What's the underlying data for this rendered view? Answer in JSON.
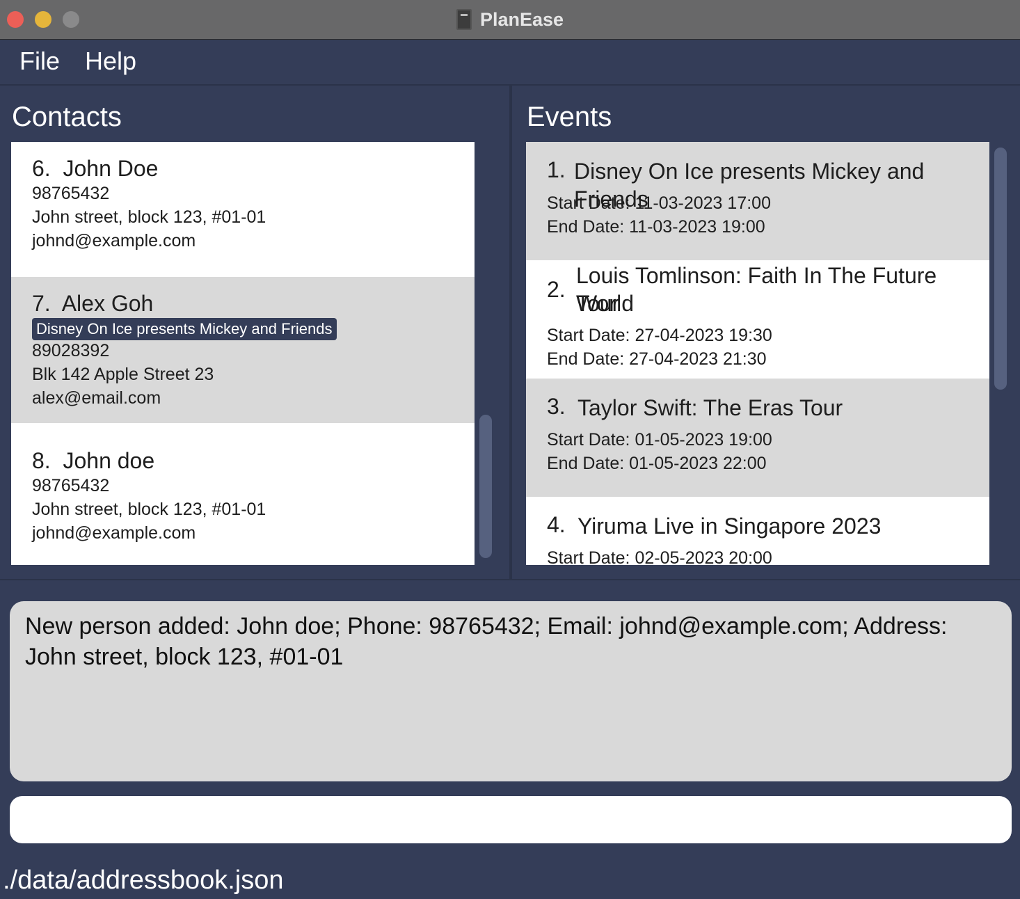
{
  "window": {
    "title": "PlanEase",
    "app_icon": "notebook-icon",
    "controls": [
      "close",
      "minimize",
      "maximize"
    ]
  },
  "menu": {
    "file": "File",
    "help": "Help"
  },
  "contacts": {
    "title": "Contacts",
    "items": [
      {
        "index": "6.",
        "name": "John Doe",
        "tags": [],
        "phone": "98765432",
        "address": "John street, block 123, #01-01",
        "email": "johnd@example.com"
      },
      {
        "index": "7.",
        "name": "Alex Goh",
        "tags": [
          "Disney On Ice presents Mickey and Friends"
        ],
        "phone": "89028392",
        "address": "Blk 142 Apple Street 23",
        "email": "alex@email.com"
      },
      {
        "index": "8.",
        "name": "John doe",
        "tags": [],
        "phone": "98765432",
        "address": "John street, block 123, #01-01",
        "email": "johnd@example.com"
      }
    ]
  },
  "events": {
    "title": "Events",
    "items": [
      {
        "index": "1.",
        "name": "Disney On Ice presents Mickey and Friends",
        "start": "Start Date: 11-03-2023 17:00",
        "end": "End Date: 11-03-2023 19:00"
      },
      {
        "index": "2.",
        "name_line1": "Louis Tomlinson: Faith In The Future World",
        "name_line2": "Tour",
        "start": "Start Date: 27-04-2023 19:30",
        "end": "End Date: 27-04-2023 21:30"
      },
      {
        "index": "3.",
        "name": "Taylor Swift: The Eras Tour",
        "start": "Start Date: 01-05-2023 19:00",
        "end": "End Date: 01-05-2023 22:00"
      },
      {
        "index": "4.",
        "name": "Yiruma Live in Singapore 2023",
        "start": "Start Date: 02-05-2023 20:00"
      }
    ]
  },
  "result": {
    "text": "New person added: John doe; Phone: 98765432; Email: johnd@example.com; Address: John street, block 123, #01-01"
  },
  "command": {
    "value": ""
  },
  "status": {
    "path": "./data/addressbook.json"
  },
  "colors": {
    "background": "#343d58",
    "card_alt": "#d9d9d9",
    "tag": "#343d58",
    "scrollbar": "#56617f"
  }
}
